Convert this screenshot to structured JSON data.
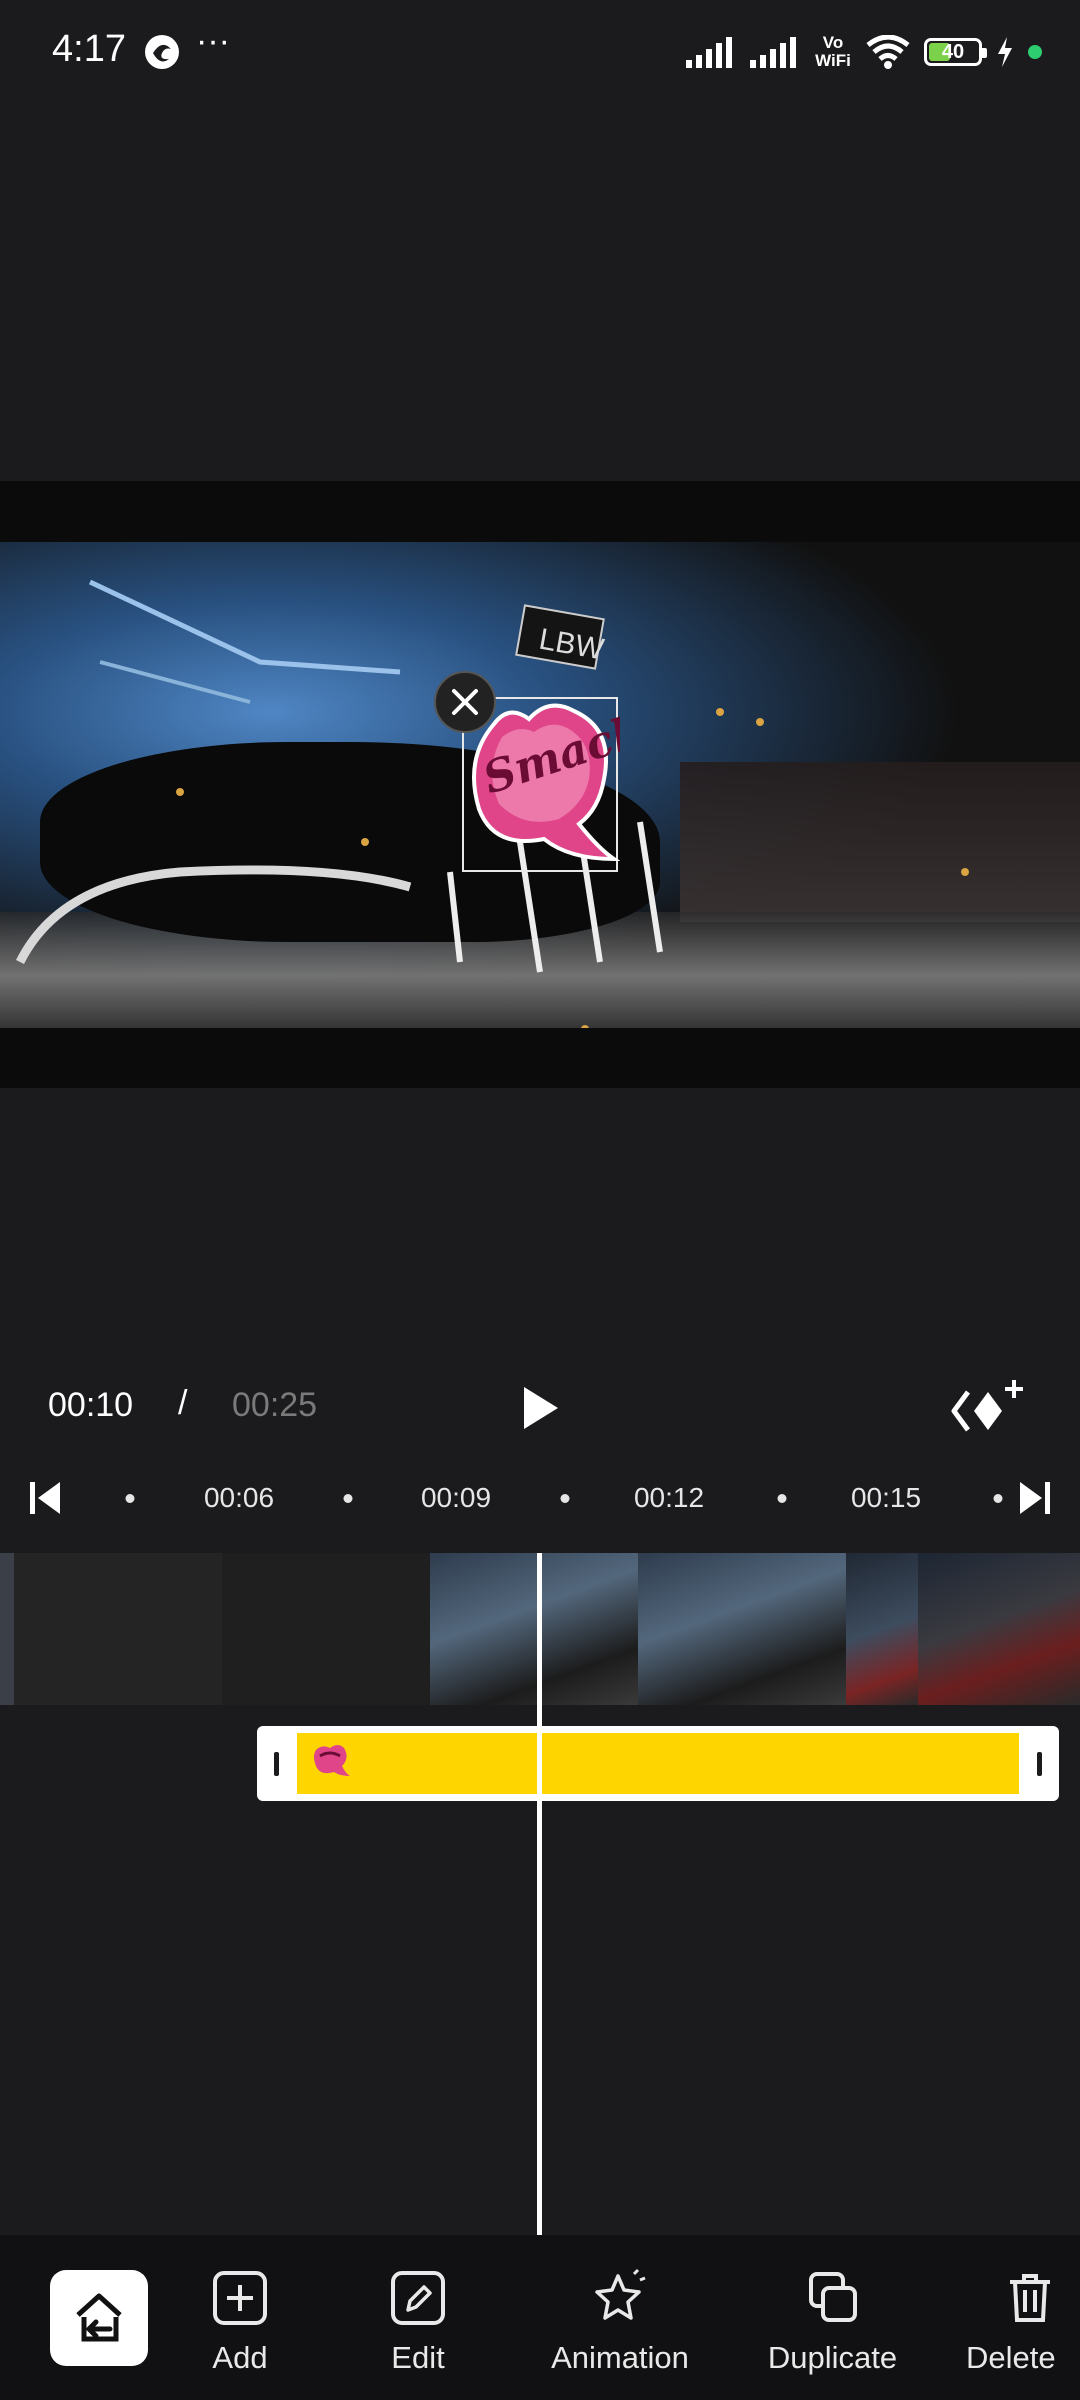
{
  "status_bar": {
    "time": "4:17",
    "more": "···",
    "network_label": "Vo WiFi",
    "battery": "40",
    "battery_level": 0.4,
    "icons": [
      "browser-icon",
      "signal-icon",
      "signal-icon",
      "vowifi-icon",
      "wifi-icon",
      "battery-icon",
      "charging-icon",
      "privacy-dot-icon"
    ]
  },
  "preview": {
    "sticker_text": "Smack!",
    "plate_text": "LBW"
  },
  "playback": {
    "current_time": "00:10",
    "separator": "/",
    "total_time": "00:25"
  },
  "ruler": {
    "labels": [
      "00:06",
      "00:09",
      "00:12",
      "00:15"
    ]
  },
  "toolbar": {
    "back_icon": "exit-icon",
    "items": [
      {
        "label": "Add",
        "icon": "add-icon"
      },
      {
        "label": "Edit",
        "icon": "pencil-icon"
      },
      {
        "label": "Animation",
        "icon": "star-icon"
      },
      {
        "label": "Duplicate",
        "icon": "duplicate-icon"
      },
      {
        "label": "Delete",
        "icon": "trash-icon"
      }
    ]
  },
  "colors": {
    "background": "#1b1b1d",
    "sticker_clip": "#ffd500",
    "sticker_pink": "#e0458a"
  }
}
